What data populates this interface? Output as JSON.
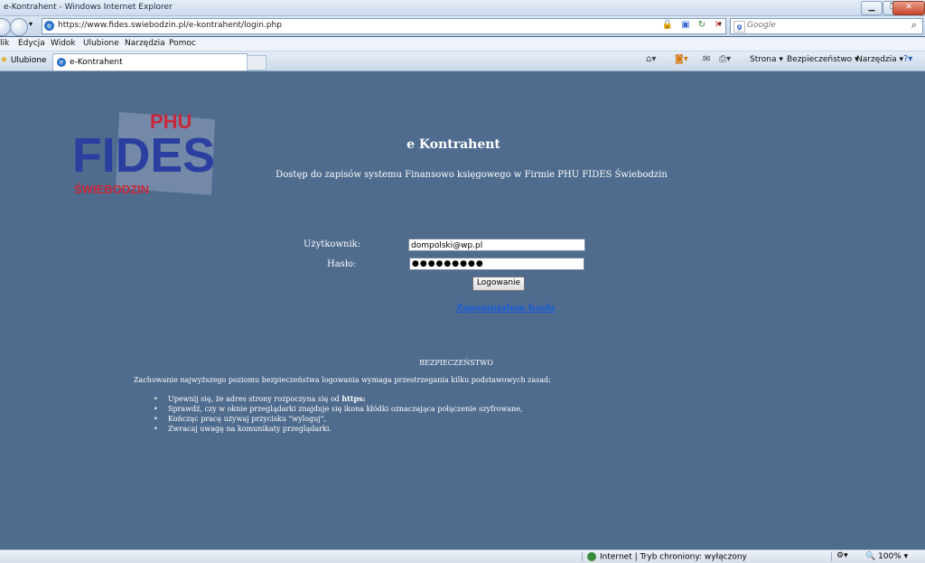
{
  "window": {
    "title": "e-Kontrahent - Windows Internet Explorer"
  },
  "address": {
    "url": "https://www.fides.swiebodzin.pl/e-kontrahent/login.php"
  },
  "search": {
    "placeholder": "Google"
  },
  "menu": [
    "lik",
    "Edycja",
    "Widok",
    "Ulubione",
    "Narzędzia",
    "Pomoc"
  ],
  "favorites": {
    "label": "Ulubione"
  },
  "tab": {
    "label": "e-Kontrahent"
  },
  "commands": {
    "page": "Strona ▾",
    "safety": "Bezpieczeństwo ▾",
    "tools": "Narzędzia ▾"
  },
  "logo": {
    "text_top": "PHU",
    "text_main": "FIDES",
    "text_bottom": "ŚWIEBODZIN",
    "color": "#2b3fa0",
    "accent": "#c8283b"
  },
  "page": {
    "title": "e Kontrahent",
    "subtitle": "Dostęp do zapisów systemu Finansowo księgowego w Firmie PHU FIDES Świebodzin",
    "user_label": "Użytkownik:",
    "user_value": "dompolski@wp.pl",
    "pass_label": "Hasło:",
    "pass_value": "●●●●●●●●●",
    "login_button": "Logowanie",
    "forgot_link": "Zapomniałem hasła"
  },
  "security": {
    "title": "BEZPIECZEŃSTWO",
    "intro": "Zachowanie najwyższego poziomu bezpieczeństwa logowania wymaga przestrzegania kilku podstawowych zasad:",
    "item1_prefix": "Upewnij się, że adres strony rozpoczyna się od ",
    "item1_bold": "https:",
    "item2": "Sprawdź, czy w oknie przeglądarki znajduje się ikona kłódki oznaczająca połączenie szyfrowane,",
    "item3": "Kończąc pracę używaj przycisku \"wyloguj\",",
    "item4": "Zwracaj uwagę na komunikaty przeglądarki."
  },
  "statusbar": {
    "zone": "Internet | Tryb chroniony: wyłączony",
    "zoom": "100%"
  }
}
